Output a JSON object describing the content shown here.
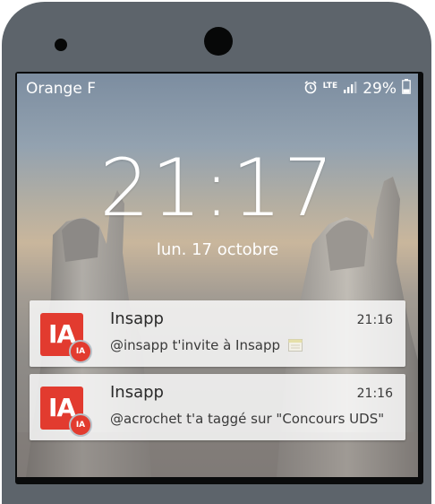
{
  "status_bar": {
    "carrier": "Orange F",
    "network": "LTE",
    "battery_percent": "29%"
  },
  "lock_screen": {
    "time": "21:17",
    "date": "lun. 17 octobre"
  },
  "notifications": [
    {
      "app_name": "Insapp",
      "icon_text": "IA",
      "badge_text": "IA",
      "time": "21:16",
      "message": "@insapp t'invite à Insapp"
    },
    {
      "app_name": "Insapp",
      "icon_text": "IA",
      "badge_text": "IA",
      "time": "21:16",
      "message": "@acrochet t'a taggé sur \"Concours UDS\""
    }
  ],
  "icons": {
    "alarm": "alarm-icon",
    "signal": "signal-icon",
    "battery": "battery-icon",
    "calendar": "calendar-emoji-icon"
  },
  "colors": {
    "device": "#5d646b",
    "app_icon": "#e23b2f",
    "notification_bg": "#f8f8f8"
  }
}
